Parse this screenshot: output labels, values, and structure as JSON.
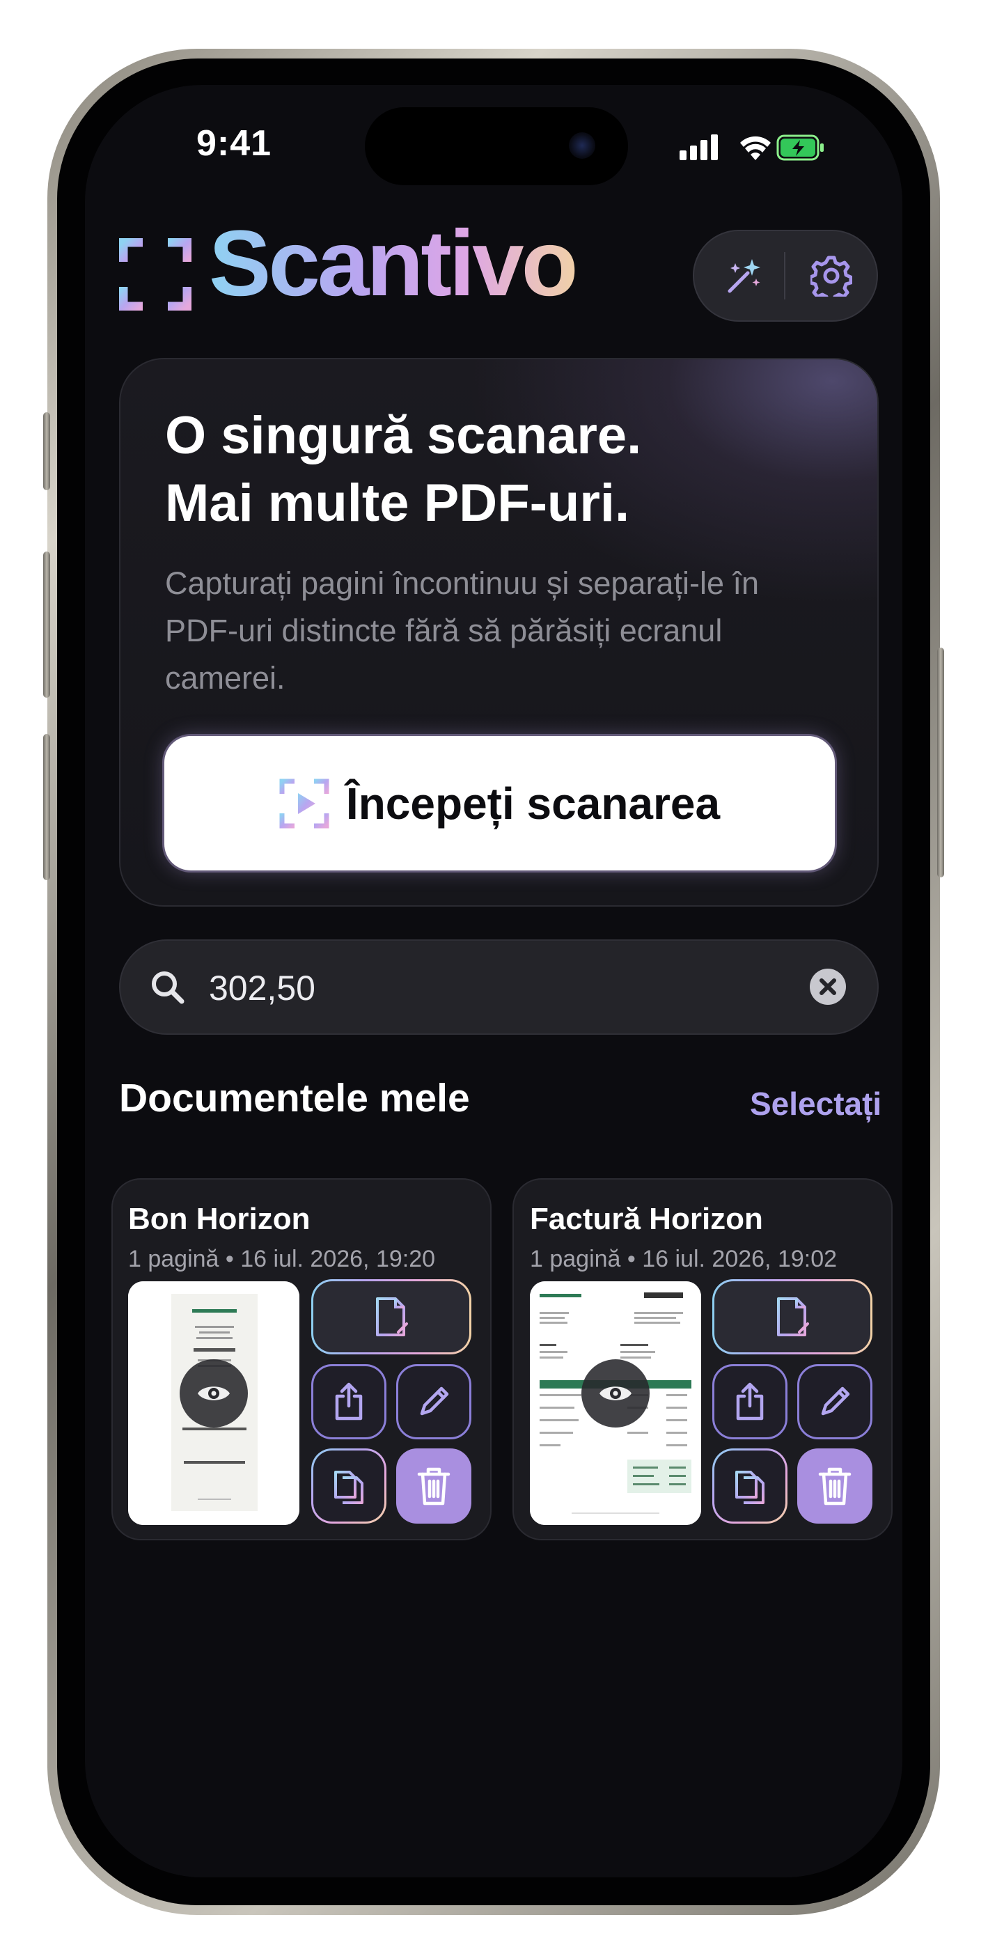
{
  "status_bar": {
    "time": "9:41"
  },
  "header": {
    "app_name": "Scantivo",
    "icons": [
      "magic-wand-icon",
      "gear-icon"
    ]
  },
  "hero": {
    "title_line1": "O singură scanare.",
    "title_line2": "Mai multe PDF-uri.",
    "subtitle": "Capturați pagini încontinuu și separați-le în PDF-uri distincte fără să părăsiți ecranul camerei.",
    "button_label": "Începeți scanarea"
  },
  "search": {
    "value": "302,50",
    "placeholder": ""
  },
  "documents": {
    "title": "Documentele mele",
    "select_label": "Selectați",
    "items": [
      {
        "title": "Bon Horizon",
        "meta": "1 pagină • 16 iul. 2026, 19:20"
      },
      {
        "title": "Factură Horizon",
        "meta": "1 pagină • 16 iul. 2026, 19:02"
      }
    ]
  },
  "colors": {
    "accent": "#aea2ee",
    "delete": "#a98fe0",
    "background": "#0c0c10"
  }
}
